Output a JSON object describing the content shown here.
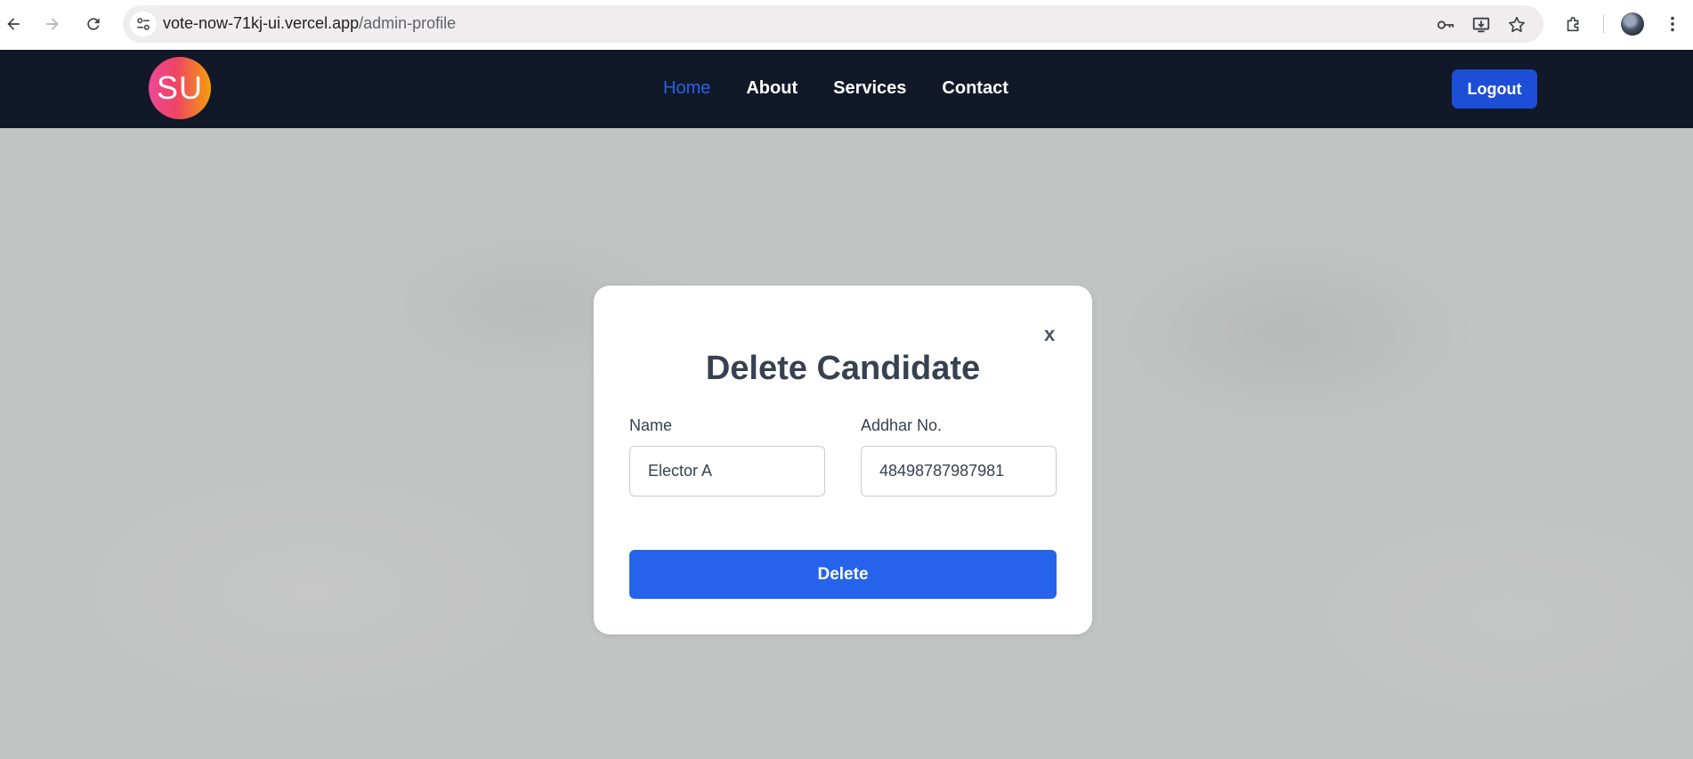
{
  "browser": {
    "url_host": "vote-now-71kj-ui.vercel.app",
    "url_path": "/admin-profile",
    "icons": [
      "back-icon",
      "forward-icon",
      "reload-icon",
      "site-settings-icon",
      "password-key-icon",
      "install-app-icon",
      "bookmark-star-icon",
      "extensions-icon",
      "profile-avatar",
      "more-menu-icon"
    ]
  },
  "header": {
    "logo_text": "SU",
    "nav": [
      {
        "label": "Home",
        "active": true
      },
      {
        "label": "About",
        "active": false
      },
      {
        "label": "Services",
        "active": false
      },
      {
        "label": "Contact",
        "active": false
      }
    ],
    "logout_label": "Logout"
  },
  "modal": {
    "close_label": "x",
    "title": "Delete Candidate",
    "name_label": "Name",
    "name_value": "Elector A",
    "addhar_label": "Addhar No.",
    "addhar_value": "48498787987981",
    "delete_label": "Delete"
  },
  "colors": {
    "header_bg": "#111827",
    "active_link": "#2563eb",
    "logout_bg": "#1d4ed8",
    "delete_bg": "#2563eb",
    "logo_gradient": [
      "#ec4899",
      "#f59e0b"
    ]
  }
}
